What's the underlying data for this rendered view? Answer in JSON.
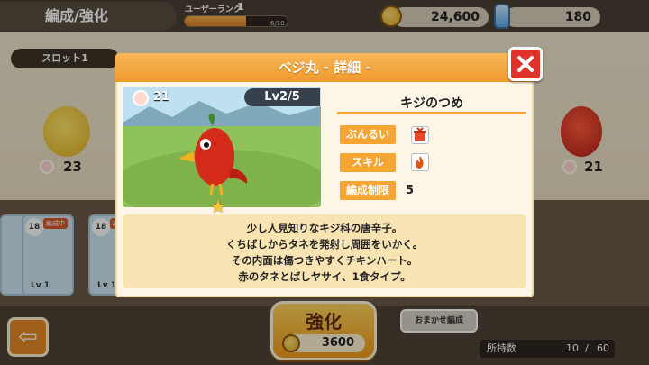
{
  "header": {
    "page_title": "編成/強化",
    "rank_label": "ユーザーランク",
    "rank_level": "1",
    "rank_progress_text": "6/10",
    "rank_progress_fraction": 0.6,
    "coins": "24,600",
    "stamina": "180"
  },
  "background": {
    "slot_tab": "スロット1",
    "left_char_count": "23",
    "right_char_count": "21",
    "cards": [
      {
        "badge": "18",
        "tag": "編成中",
        "level": "Lv 1"
      },
      {
        "badge": "18",
        "tag": "編成中",
        "level": "Lv 1"
      }
    ],
    "auto_button": "おまかせ編成",
    "owned_label": "所持数",
    "owned_value": "10",
    "owned_sep": "/",
    "owned_max": "60",
    "enhance_label": "強化",
    "enhance_cost": "3600",
    "back_icon": "back-arrow-icon"
  },
  "modal": {
    "title": "ベジ丸 - 詳細 -",
    "close_icon": "close-icon",
    "portrait_count": "21",
    "level_badge": "Lv2/5",
    "item_name": "キジのつめ",
    "stats": [
      {
        "label": "ぶんるい",
        "icon": "category-icon"
      },
      {
        "label": "スキル",
        "icon": "fire-skill-icon"
      },
      {
        "label": "編成制限",
        "value": "5"
      }
    ],
    "description_lines": [
      "少し人見知りなキジ科の唐辛子。",
      "くちばしからタネを発射し周囲をいかく。",
      "その内面は傷つきやすくチキンハート。",
      "赤のタネとばしヤサイ、1食タイプ。"
    ]
  },
  "colors": {
    "accent_orange": "#ee9a2c",
    "close_red": "#e0322a",
    "desc_bg": "#f8e3b3"
  }
}
